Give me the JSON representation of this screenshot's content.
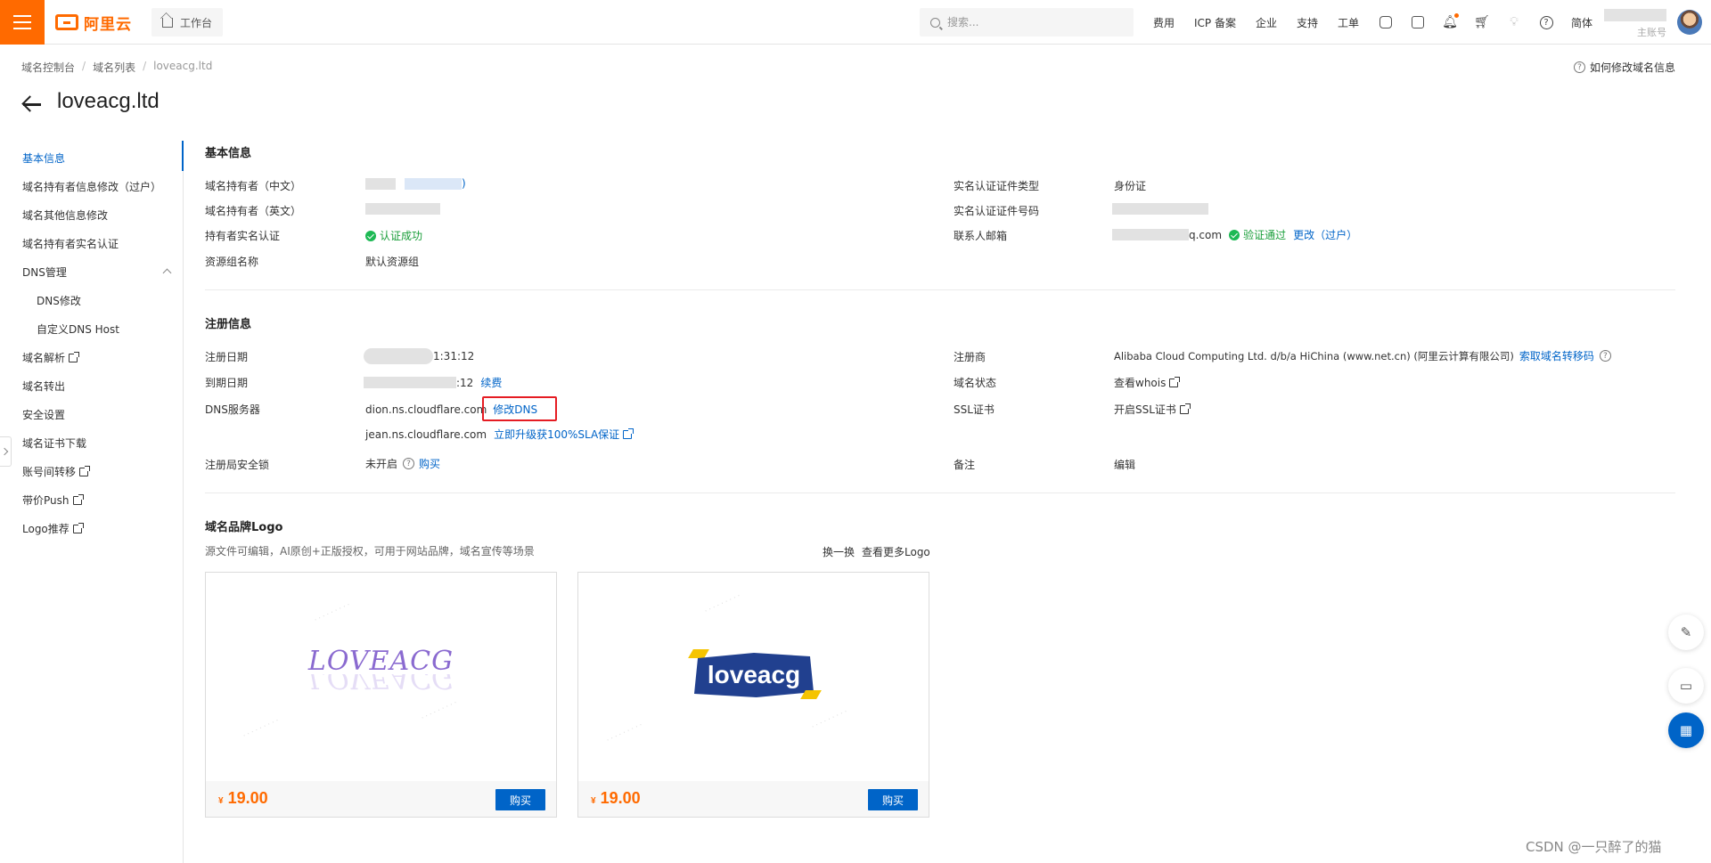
{
  "topbar": {
    "brand": "阿里云",
    "workbench": "工作台",
    "search_placeholder": "搜索...",
    "nav": [
      "费用",
      "ICP 备案",
      "企业",
      "支持",
      "工单"
    ],
    "lang": "简体",
    "user_sub": "主账号",
    "icons": [
      "code-icon",
      "terminal-icon",
      "bell-icon",
      "cart-icon",
      "bulb-icon",
      "help-icon"
    ],
    "accent": "#ff6a00"
  },
  "breadcrumb": [
    "域名控制台",
    "域名列表",
    "loveacg.ltd"
  ],
  "help_link": "如何修改域名信息",
  "page_title": "loveacg.ltd",
  "sidebar": {
    "items": [
      {
        "label": "基本信息",
        "active": true
      },
      {
        "label": "域名持有者信息修改（过户）"
      },
      {
        "label": "域名其他信息修改"
      },
      {
        "label": "域名持有者实名认证"
      },
      {
        "label": "DNS管理",
        "expanded": true
      },
      {
        "label": "DNS修改",
        "sub": true
      },
      {
        "label": "自定义DNS Host",
        "sub": true
      },
      {
        "label": "域名解析",
        "external": true
      },
      {
        "label": "域名转出"
      },
      {
        "label": "安全设置"
      },
      {
        "label": "域名证书下载"
      },
      {
        "label": "账号间转移",
        "external": true
      },
      {
        "label": "带价Push",
        "external": true
      },
      {
        "label": "Logo推荐",
        "external": true
      }
    ]
  },
  "basic_info": {
    "title": "基本信息",
    "holder_cn_label": "域名持有者（中文）",
    "holder_cn_suffix": ")",
    "holder_en_label": "域名持有者（英文）",
    "verify_label": "持有者实名认证",
    "verify_status": "认证成功",
    "group_label": "资源组名称",
    "group_value": "默认资源组",
    "cert_type_label": "实名认证证件类型",
    "cert_type_value": "身份证",
    "cert_no_label": "实名认证证件号码",
    "email_label": "联系人邮箱",
    "email_suffix": "q.com",
    "email_status": "验证通过",
    "email_change": "更改（过户）"
  },
  "reg_info": {
    "title": "注册信息",
    "reg_date_label": "注册日期",
    "reg_date_suffix": "1:31:12",
    "exp_date_label": "到期日期",
    "exp_date_suffix": ":12",
    "renew": "续费",
    "dns_label": "DNS服务器",
    "dns1": "dion.ns.cloudflare.com",
    "dns_modify": "修改DNS",
    "dns2": "jean.ns.cloudflare.com",
    "sla_upgrade": "立即升级获100%SLA保证",
    "lock_label": "注册局安全锁",
    "lock_value": "未开启",
    "lock_buy": "购买",
    "registrar_label": "注册商",
    "registrar_value": "Alibaba Cloud Computing Ltd. d/b/a HiChina (www.net.cn) (阿里云计算有限公司)",
    "transfer_code": "索取域名转移码",
    "status_label": "域名状态",
    "whois": "查看whois",
    "ssl_label": "SSL证书",
    "ssl_open": "开启SSL证书",
    "remark_label": "备注",
    "remark_edit": "编辑"
  },
  "logo_section": {
    "title": "域名品牌Logo",
    "desc": "源文件可编辑，AI原创+正版授权，可用于网站品牌，域名宣传等场景",
    "swap": "换一换",
    "more": "查看更多Logo",
    "cards": [
      {
        "logo_text": "LOVEACG",
        "currency": "¥",
        "price": "19.00",
        "buy": "购买"
      },
      {
        "logo_text": "loveacg",
        "currency": "¥",
        "price": "19.00",
        "buy": "购买"
      }
    ]
  },
  "watermark": "CSDN @一只醉了的猫"
}
